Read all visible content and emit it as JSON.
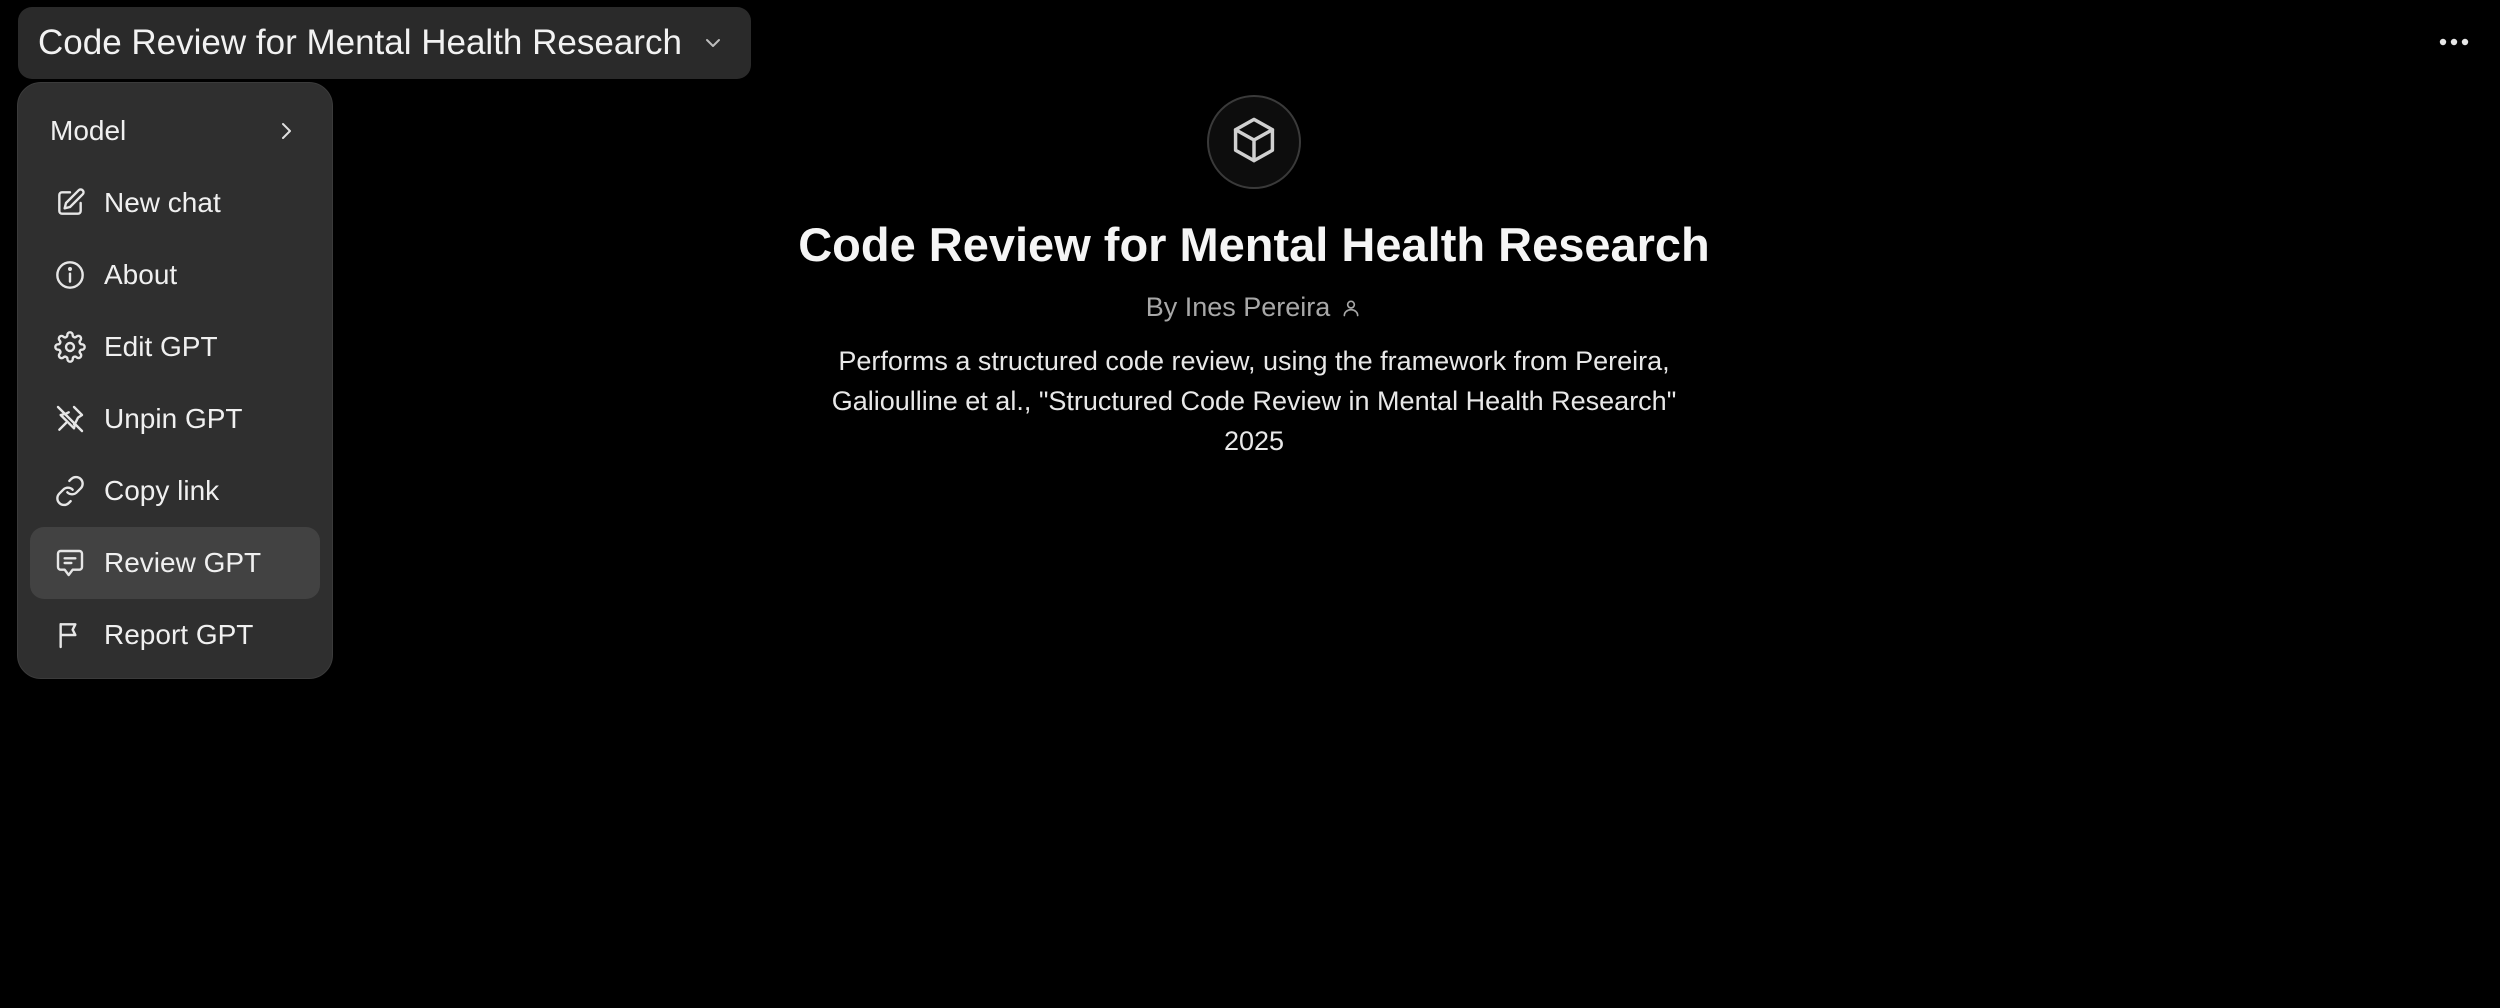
{
  "header": {
    "selector_title": "Code Review for Mental Health Research",
    "selector_icon": "chevron-down-icon",
    "more_icon": "ellipsis-icon"
  },
  "menu": {
    "items": [
      {
        "label": "Model",
        "icon": "chevron-right-icon",
        "active": false
      },
      {
        "label": "New chat",
        "icon": "edit-icon",
        "active": false
      },
      {
        "label": "About",
        "icon": "info-icon",
        "active": false
      },
      {
        "label": "Edit GPT",
        "icon": "gear-icon",
        "active": false
      },
      {
        "label": "Unpin GPT",
        "icon": "unpin-icon",
        "active": false
      },
      {
        "label": "Copy link",
        "icon": "link-icon",
        "active": false
      },
      {
        "label": "Review GPT",
        "icon": "review-icon",
        "active": true
      },
      {
        "label": "Report GPT",
        "icon": "flag-icon",
        "active": false
      }
    ]
  },
  "gpt": {
    "avatar_icon": "cube-icon",
    "name": "Code Review for Mental Health Research",
    "author": "By Ines Pereira",
    "author_icon": "person-icon",
    "description": "Performs a structured code review, using the framework from Pereira, Galioulline et al., \"Structured Code Review in Mental Health Research\" 2025"
  },
  "colors": {
    "background": "#000000",
    "menu_background": "#2f2f2f",
    "menu_active": "#424242",
    "selector_background": "#2a2a2a",
    "muted_text": "#a8a8a8"
  }
}
